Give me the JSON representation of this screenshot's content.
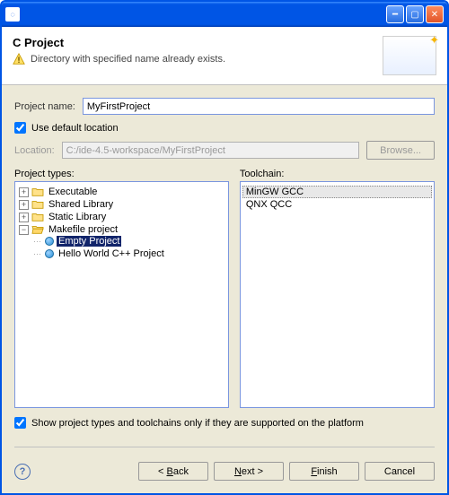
{
  "titlebar": {
    "title": ""
  },
  "header": {
    "title": "C Project",
    "warning": "Directory with specified name already exists."
  },
  "project_name": {
    "label": "Project name:",
    "value": "MyFirstProject"
  },
  "use_default": {
    "label": "Use default location",
    "checked": true
  },
  "location": {
    "label": "Location:",
    "value": "C:/ide-4.5-workspace/MyFirstProject",
    "browse": "Browse..."
  },
  "project_types": {
    "label": "Project types:",
    "items": [
      {
        "label": "Executable",
        "expanded": false
      },
      {
        "label": "Shared Library",
        "expanded": false
      },
      {
        "label": "Static Library",
        "expanded": false
      },
      {
        "label": "Makefile project",
        "expanded": true,
        "children": [
          {
            "label": "Empty Project",
            "selected": true
          },
          {
            "label": "Hello World C++ Project",
            "selected": false
          }
        ]
      }
    ]
  },
  "toolchain": {
    "label": "Toolchain:",
    "items": [
      {
        "label": "MinGW GCC",
        "selected": true
      },
      {
        "label": "QNX QCC",
        "selected": false
      }
    ]
  },
  "filter": {
    "label": "Show project types and toolchains only if they are supported on the platform",
    "checked": true
  },
  "buttons": {
    "back": "< Back",
    "next": "Next >",
    "finish": "Finish",
    "cancel": "Cancel"
  }
}
